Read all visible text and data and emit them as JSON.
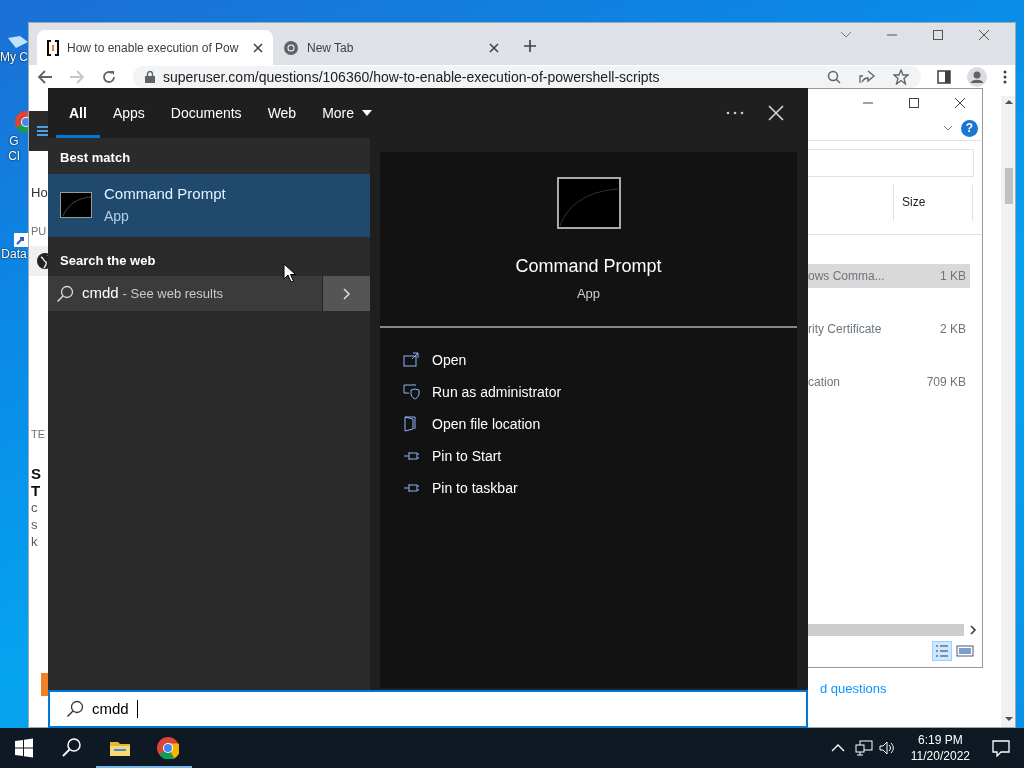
{
  "desktop_icons": [
    {
      "lines": [
        "My C"
      ],
      "kind": "computer"
    },
    {
      "lines": [
        "G",
        "Cl"
      ],
      "kind": "chrome"
    },
    {
      "lines": [
        "Data"
      ],
      "kind": "shortcut"
    }
  ],
  "browser": {
    "tabs": [
      {
        "title": "How to enable execution of Pow",
        "selected": true,
        "kind": "site"
      },
      {
        "title": "New Tab",
        "selected": false,
        "kind": "chrome"
      }
    ],
    "address": "superuser.com/questions/106360/how-to-enable-execution-of-powershell-scripts",
    "page_fragments": [
      {
        "text": "Ho",
        "kind": "nav"
      },
      {
        "text": "PU",
        "kind": "label"
      },
      {
        "text": "TE",
        "kind": "label"
      },
      {
        "text": "S",
        "kind": "title"
      },
      {
        "text": "T",
        "kind": "title"
      },
      {
        "text": "c",
        "kind": "body"
      },
      {
        "text": "s",
        "kind": "body"
      },
      {
        "text": "k",
        "kind": "body"
      }
    ],
    "link_fragment": "d questions"
  },
  "explorer": {
    "help": "?",
    "columns": [
      "Size"
    ],
    "rows": [
      {
        "name": "ows Comma...",
        "size": "1 KB",
        "selected": true
      },
      {
        "name": "rity Certificate",
        "size": "2 KB",
        "selected": false
      },
      {
        "name": "cation",
        "size": "709 KB",
        "selected": false
      }
    ]
  },
  "search": {
    "tabs": [
      {
        "label": "All",
        "selected": true,
        "kind": "tab"
      },
      {
        "label": "Apps",
        "selected": false,
        "kind": "tab"
      },
      {
        "label": "Documents",
        "selected": false,
        "kind": "tab"
      },
      {
        "label": "Web",
        "selected": false,
        "kind": "tab"
      },
      {
        "label": "More",
        "selected": false,
        "kind": "dropdown"
      }
    ],
    "best_match_heading": "Best match",
    "best_match": {
      "title": "Command Prompt",
      "subtitle": "App",
      "selected": true
    },
    "web_heading": "Search the web",
    "web_result": {
      "query": "cmdd",
      "hint": "- See web results"
    },
    "preview": {
      "title": "Command Prompt",
      "subtitle": "App",
      "actions": [
        {
          "label": "Open",
          "kind": "open"
        },
        {
          "label": "Run as administrator",
          "kind": "admin"
        },
        {
          "label": "Open file location",
          "kind": "folder"
        },
        {
          "label": "Pin to Start",
          "kind": "pin"
        },
        {
          "label": "Pin to taskbar",
          "kind": "pin"
        }
      ]
    },
    "query": "cmdd"
  },
  "taskbar": {
    "apps": [
      {
        "kind": "explorer",
        "running": true
      },
      {
        "kind": "chrome",
        "running": true
      }
    ],
    "time": "6:19 PM",
    "date": "11/20/2022"
  }
}
